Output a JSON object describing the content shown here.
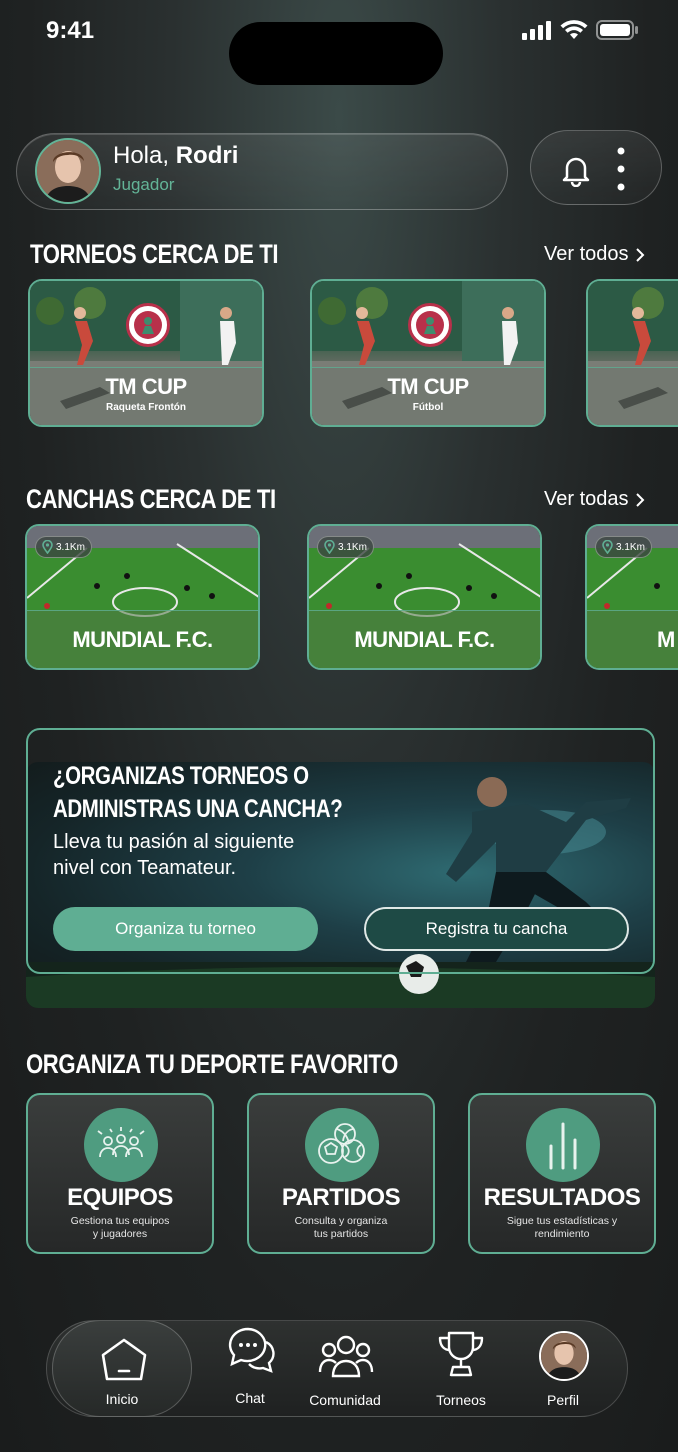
{
  "status_bar": {
    "time": "9:41"
  },
  "header": {
    "greeting": "Hola,",
    "user_name": "Rodri",
    "role": "Jugador"
  },
  "tournaments": {
    "title": "TORNEOS CERCA DE TI",
    "see_all": "Ver todos",
    "items": [
      {
        "name": "TM CUP",
        "sport": "Raqueta Frontón",
        "logo_text": "TEAMATEUR"
      },
      {
        "name": "TM CUP",
        "sport": "Fútbol",
        "logo_text": "TEAMATEUR"
      },
      {
        "name": "",
        "sport": ""
      }
    ]
  },
  "courts": {
    "title": "CANCHAS CERCA DE TI",
    "see_all": "Ver todas",
    "items": [
      {
        "name": "MUNDIAL F.C.",
        "distance": "3.1Km"
      },
      {
        "name": "MUNDIAL F.C.",
        "distance": "3.1Km"
      },
      {
        "name": "M",
        "distance": "3.1Km"
      }
    ]
  },
  "promo": {
    "title_line1": "¿ORGANIZAS TORNEOS O",
    "title_line2": "ADMINISTRAS UNA CANCHA?",
    "body_line1": "Lleva tu pasión al siguiente",
    "body_line2": "nivel con Teamateur.",
    "primary_button": "Organiza tu torneo",
    "secondary_button": "Registra tu cancha"
  },
  "features": {
    "title": "ORGANIZA TU DEPORTE FAVORITO",
    "items": [
      {
        "title": "EQUIPOS",
        "subtitle_line1": "Gestiona tus equipos",
        "subtitle_line2": "y jugadores",
        "icon": "team-icon"
      },
      {
        "title": "PARTIDOS",
        "subtitle_line1": "Consulta y organiza",
        "subtitle_line2": "tus partidos",
        "icon": "balls-icon"
      },
      {
        "title": "RESULTADOS",
        "subtitle_line1": "Sigue tus estadísticas y",
        "subtitle_line2": "rendimiento",
        "icon": "bar-chart-icon"
      }
    ]
  },
  "bottom_nav": {
    "items": [
      {
        "label": "Inicio",
        "icon": "home-icon",
        "active": true
      },
      {
        "label": "Chat",
        "icon": "chat-icon"
      },
      {
        "label": "Comunidad",
        "icon": "community-icon"
      },
      {
        "label": "Torneos",
        "icon": "trophy-icon"
      },
      {
        "label": "Perfil",
        "icon": "avatar"
      }
    ]
  },
  "colors": {
    "accent": "#5fae93",
    "background": "#1f2222",
    "button_dark": "#1e4a45"
  }
}
